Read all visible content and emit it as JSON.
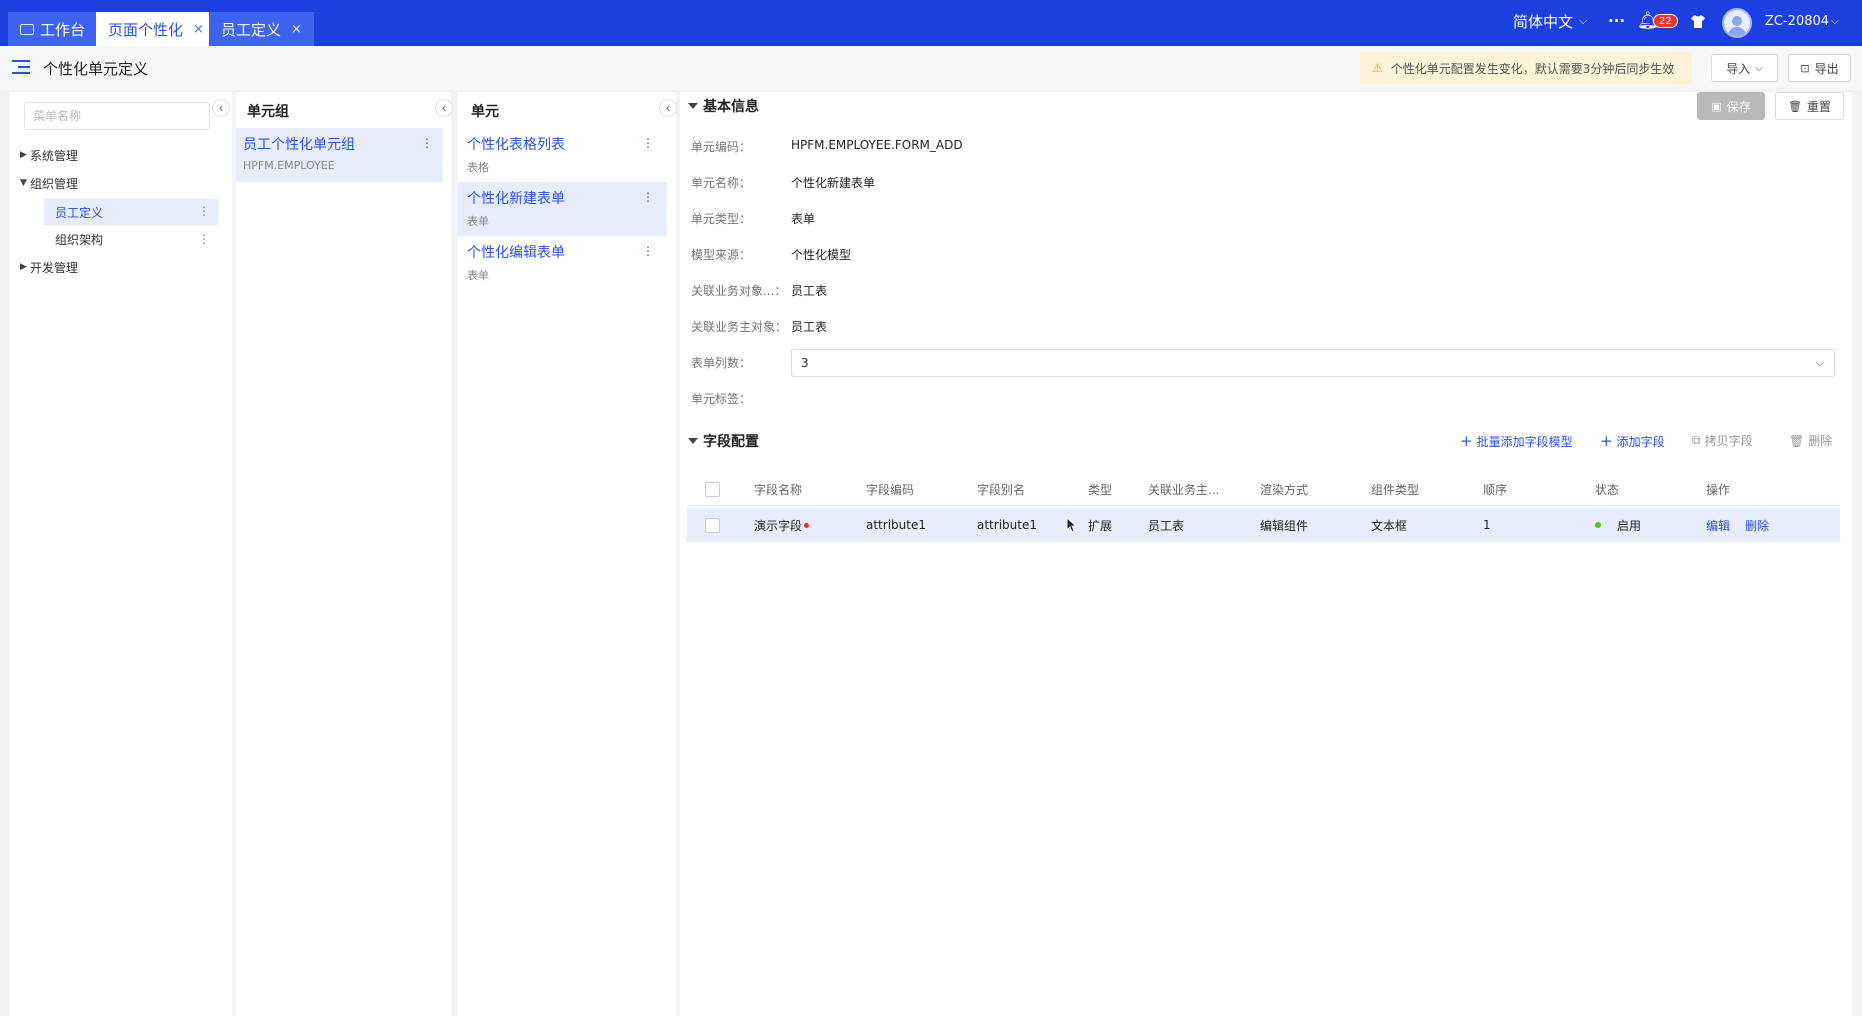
{
  "tabs": [
    {
      "label": "工作台",
      "closable": false
    },
    {
      "label": "页面个性化",
      "closable": true
    },
    {
      "label": "员工定义",
      "closable": true
    }
  ],
  "topbar": {
    "language": "简体中文",
    "more": "···",
    "notification_count": "22",
    "user": "ZC-20804"
  },
  "page": {
    "title": "个性化单元定义",
    "notice": "个性化单元配置发生变化，默认需要3分钟后同步生效",
    "import_label": "导入",
    "export_label": "导出",
    "save_label": "保存",
    "reset_label": "重置"
  },
  "menu": {
    "search_placeholder": "菜单名称",
    "items": [
      {
        "label": "系统管理"
      },
      {
        "label": "组织管理"
      },
      {
        "label": "员工定义"
      },
      {
        "label": "组织架构"
      },
      {
        "label": "开发管理"
      }
    ]
  },
  "unit_group": {
    "header": "单元组",
    "items": [
      {
        "title": "员工个性化单元组",
        "sub": "HPFM.EMPLOYEE"
      }
    ]
  },
  "units": {
    "header": "单元",
    "items": [
      {
        "title": "个性化表格列表",
        "sub": "表格"
      },
      {
        "title": "个性化新建表单",
        "sub": "表单"
      },
      {
        "title": "个性化编辑表单",
        "sub": "表单"
      }
    ]
  },
  "basic_info": {
    "header": "基本信息",
    "fields": [
      {
        "label": "单元编码：",
        "value": "HPFM.EMPLOYEE.FORM_ADD"
      },
      {
        "label": "单元名称：",
        "value": "个性化新建表单"
      },
      {
        "label": "单元类型：",
        "value": "表单"
      },
      {
        "label": "模型来源：",
        "value": "个性化模型"
      },
      {
        "label": "关联业务对象...：",
        "value": "员工表"
      },
      {
        "label": "关联业务主对象：",
        "value": "员工表"
      },
      {
        "label": "表单列数：",
        "value": "3"
      },
      {
        "label": "单元标签：",
        "value": ""
      }
    ]
  },
  "field_config": {
    "header": "字段配置",
    "actions": {
      "batch_add": "批量添加字段模型",
      "add": "添加字段",
      "copy": "拷贝字段",
      "delete": "删除"
    },
    "columns": [
      "字段名称",
      "字段编码",
      "字段别名",
      "类型",
      "关联业务主...",
      "渲染方式",
      "组件类型",
      "顺序",
      "状态",
      "操作"
    ],
    "rows": [
      {
        "name": "演示字段",
        "code": "attribute1",
        "alias": "attribute1",
        "type": "扩展",
        "biz_obj": "员工表",
        "render": "编辑组件",
        "component": "文本框",
        "order": "1",
        "status": "启用",
        "edit": "编辑",
        "delete": "删除"
      }
    ]
  },
  "colors": {
    "brand": "#1c3fe0",
    "link": "#2b50e6",
    "selected_bg": "#e7edfc",
    "status_green": "#52c41a",
    "required_red": "#e0332e"
  }
}
